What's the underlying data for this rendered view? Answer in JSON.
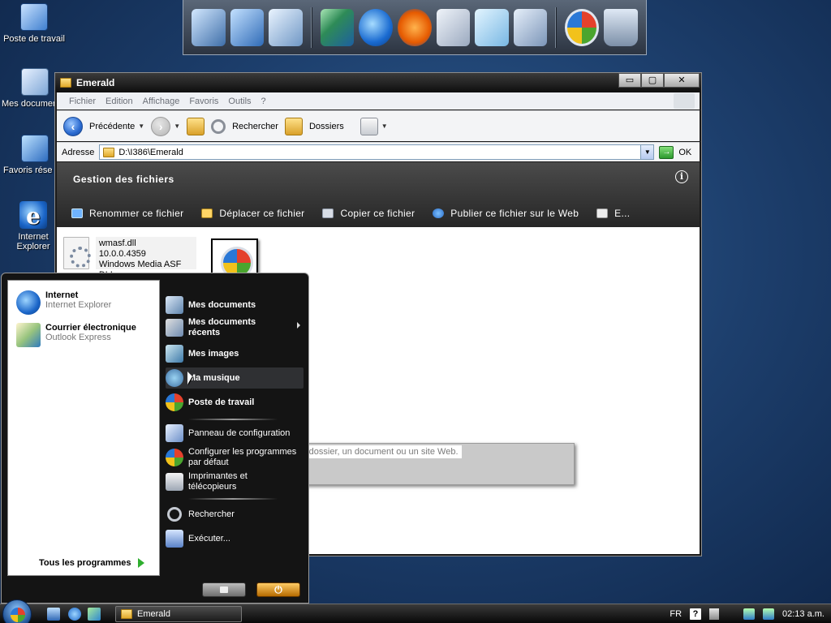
{
  "desktop": {
    "icons": [
      {
        "label": "Poste de travail",
        "icon": "my-computer-icon"
      },
      {
        "label": "Mes documer",
        "icon": "my-documents-icon"
      },
      {
        "label": "Favoris rése",
        "icon": "network-places-icon"
      },
      {
        "label": "Internet Explorer",
        "icon": "internet-explorer-icon"
      }
    ]
  },
  "dock": {
    "items": [
      "my-computer-icon",
      "network-icon",
      "documents-icon",
      "monitor-icon",
      "internet-explorer-icon",
      "media-player-icon",
      "calculator-icon",
      "notepad-icon",
      "tablet-icon",
      "windows-logo-icon",
      "recycle-bin-icon"
    ]
  },
  "explorer": {
    "title": "Emerald",
    "controls": {
      "minimize": "▭",
      "maximize": "▢",
      "close": "✕"
    },
    "menu": [
      "Fichier",
      "Edition",
      "Affichage",
      "Favoris",
      "Outils",
      "?"
    ],
    "toolbar": {
      "back_label": "Précédente",
      "search_label": "Rechercher",
      "folders_label": "Dossiers"
    },
    "address": {
      "label": "Adresse",
      "path": "D:\\I386\\Emerald",
      "go_label": "OK"
    },
    "tasks": {
      "title": "Gestion des fichiers",
      "info": "i",
      "items": [
        "Renommer ce fichier",
        "Déplacer ce fichier",
        "Copier ce fichier",
        "Publier ce fichier sur le Web",
        "E..."
      ]
    },
    "file": {
      "name": "wmasf.dll",
      "version": "10.0.0.4359",
      "description": "Windows Media ASF DLL"
    }
  },
  "start_menu": {
    "pinned": [
      {
        "main": "Internet",
        "sub": "Internet Explorer"
      },
      {
        "main": "Courrier électronique",
        "sub": "Outlook Express"
      }
    ],
    "all_programs": "Tous les programmes",
    "right": {
      "my_documents": "Mes documents",
      "recent_documents": "Mes documents récents",
      "my_pictures": "Mes images",
      "my_music": "Ma musique",
      "my_computer": "Poste de travail",
      "control_panel": "Panneau de configuration",
      "default_programs": "Configurer les programmes par défaut",
      "printers": "Imprimantes et télécopieurs",
      "search": "Rechercher",
      "run": "Exécuter..."
    },
    "tooltip": "programme, un dossier, un document ou un site Web.",
    "power_symbol": "⏻"
  },
  "taskbar": {
    "task_label": "Emerald",
    "language": "FR",
    "help": "?",
    "clock": "02:13 a.m."
  }
}
